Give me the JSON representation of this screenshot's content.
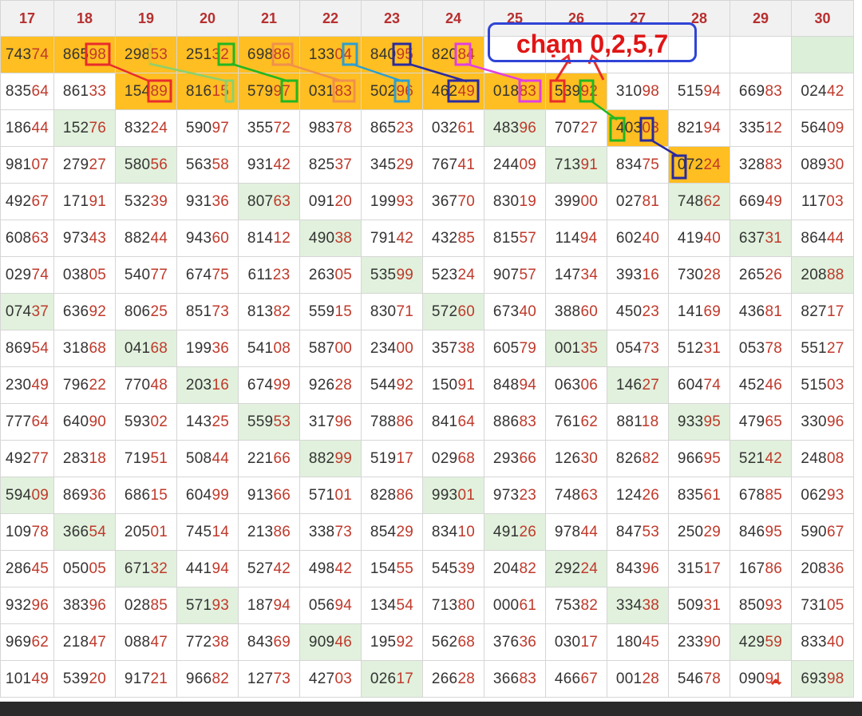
{
  "headers": [
    "17",
    "18",
    "19",
    "20",
    "21",
    "22",
    "23",
    "24",
    "25",
    "26",
    "27",
    "28",
    "29",
    "30"
  ],
  "annotation_text": "chạm 0,2,5,7",
  "scroll_top_icon": "chevron-up-icon",
  "colors": {
    "gold": "#ffbe21",
    "green": "#e1f1dd",
    "tail_red": "#c0392b",
    "note_border": "#2f44d6",
    "note_text": "#e01515"
  },
  "rows": [
    [
      [
        "74374",
        "gold"
      ],
      [
        "86598",
        "gold"
      ],
      [
        "29853",
        "gold"
      ],
      [
        "25132",
        "gold"
      ],
      [
        "69886",
        "gold"
      ],
      [
        "13304",
        "gold"
      ],
      [
        "84095",
        "gold"
      ],
      [
        "82084",
        "gold"
      ],
      [
        "",
        ""
      ],
      [
        "",
        ""
      ],
      [
        "",
        ""
      ],
      [
        "",
        ""
      ],
      [
        "",
        "empty"
      ],
      [
        "",
        "emptygreen"
      ]
    ],
    [
      [
        "83564",
        ""
      ],
      [
        "86133",
        ""
      ],
      [
        "15489",
        "gold"
      ],
      [
        "81615",
        "gold"
      ],
      [
        "57997",
        "gold"
      ],
      [
        "03183",
        "gold"
      ],
      [
        "50296",
        "gold"
      ],
      [
        "46249",
        "gold"
      ],
      [
        "01883",
        "gold"
      ],
      [
        "53992",
        "gold"
      ],
      [
        "31098",
        ""
      ],
      [
        "51594",
        ""
      ],
      [
        "66983",
        ""
      ],
      [
        "02442",
        ""
      ]
    ],
    [
      [
        "18644",
        ""
      ],
      [
        "15276",
        "green"
      ],
      [
        "83224",
        ""
      ],
      [
        "59097",
        ""
      ],
      [
        "35572",
        ""
      ],
      [
        "98378",
        ""
      ],
      [
        "86523",
        ""
      ],
      [
        "03261",
        ""
      ],
      [
        "48396",
        "green"
      ],
      [
        "70727",
        ""
      ],
      [
        "40303",
        "gold"
      ],
      [
        "82194",
        ""
      ],
      [
        "33512",
        ""
      ],
      [
        "56409",
        ""
      ]
    ],
    [
      [
        "98107",
        ""
      ],
      [
        "27927",
        ""
      ],
      [
        "58056",
        "green"
      ],
      [
        "56358",
        ""
      ],
      [
        "93142",
        ""
      ],
      [
        "82537",
        ""
      ],
      [
        "34529",
        ""
      ],
      [
        "76741",
        ""
      ],
      [
        "24409",
        ""
      ],
      [
        "71391",
        "green"
      ],
      [
        "83475",
        ""
      ],
      [
        "07224",
        "gold"
      ],
      [
        "32883",
        ""
      ],
      [
        "08930",
        ""
      ]
    ],
    [
      [
        "49267",
        ""
      ],
      [
        "17191",
        ""
      ],
      [
        "53239",
        ""
      ],
      [
        "93136",
        ""
      ],
      [
        "80763",
        "green"
      ],
      [
        "09120",
        ""
      ],
      [
        "19993",
        ""
      ],
      [
        "36770",
        ""
      ],
      [
        "83019",
        ""
      ],
      [
        "39900",
        ""
      ],
      [
        "02781",
        ""
      ],
      [
        "74862",
        "green"
      ],
      [
        "66949",
        ""
      ],
      [
        "11703",
        ""
      ]
    ],
    [
      [
        "60863",
        ""
      ],
      [
        "97343",
        ""
      ],
      [
        "88244",
        ""
      ],
      [
        "94360",
        ""
      ],
      [
        "81412",
        ""
      ],
      [
        "49038",
        "green"
      ],
      [
        "79142",
        ""
      ],
      [
        "43285",
        ""
      ],
      [
        "81557",
        ""
      ],
      [
        "11494",
        ""
      ],
      [
        "60240",
        ""
      ],
      [
        "41940",
        ""
      ],
      [
        "63731",
        "green"
      ],
      [
        "86444",
        ""
      ]
    ],
    [
      [
        "02974",
        ""
      ],
      [
        "03805",
        ""
      ],
      [
        "54077",
        ""
      ],
      [
        "67475",
        ""
      ],
      [
        "61123",
        ""
      ],
      [
        "26305",
        ""
      ],
      [
        "53599",
        "green"
      ],
      [
        "52324",
        ""
      ],
      [
        "90757",
        ""
      ],
      [
        "14734",
        ""
      ],
      [
        "39316",
        ""
      ],
      [
        "73028",
        ""
      ],
      [
        "26526",
        ""
      ],
      [
        "20888",
        "green"
      ]
    ],
    [
      [
        "07437",
        "green"
      ],
      [
        "63692",
        ""
      ],
      [
        "80625",
        ""
      ],
      [
        "85173",
        ""
      ],
      [
        "81382",
        ""
      ],
      [
        "55915",
        ""
      ],
      [
        "83071",
        ""
      ],
      [
        "57260",
        "green"
      ],
      [
        "67340",
        ""
      ],
      [
        "38860",
        ""
      ],
      [
        "45023",
        ""
      ],
      [
        "14169",
        ""
      ],
      [
        "43681",
        ""
      ],
      [
        "82717",
        ""
      ]
    ],
    [
      [
        "86954",
        ""
      ],
      [
        "31868",
        ""
      ],
      [
        "04168",
        "green"
      ],
      [
        "19936",
        ""
      ],
      [
        "54108",
        ""
      ],
      [
        "58700",
        ""
      ],
      [
        "23400",
        ""
      ],
      [
        "35738",
        ""
      ],
      [
        "60579",
        ""
      ],
      [
        "00135",
        "green"
      ],
      [
        "05473",
        ""
      ],
      [
        "51231",
        ""
      ],
      [
        "05378",
        ""
      ],
      [
        "55127",
        ""
      ]
    ],
    [
      [
        "23049",
        ""
      ],
      [
        "79622",
        ""
      ],
      [
        "77048",
        ""
      ],
      [
        "20316",
        "green"
      ],
      [
        "67499",
        ""
      ],
      [
        "92628",
        ""
      ],
      [
        "54492",
        ""
      ],
      [
        "15091",
        ""
      ],
      [
        "84894",
        ""
      ],
      [
        "06306",
        ""
      ],
      [
        "14627",
        "green"
      ],
      [
        "60474",
        ""
      ],
      [
        "45246",
        ""
      ],
      [
        "51503",
        ""
      ]
    ],
    [
      [
        "77764",
        ""
      ],
      [
        "64090",
        ""
      ],
      [
        "59302",
        ""
      ],
      [
        "14325",
        ""
      ],
      [
        "55953",
        "green"
      ],
      [
        "31796",
        ""
      ],
      [
        "78886",
        ""
      ],
      [
        "84164",
        ""
      ],
      [
        "88683",
        ""
      ],
      [
        "76162",
        ""
      ],
      [
        "88118",
        ""
      ],
      [
        "93395",
        "green"
      ],
      [
        "47965",
        ""
      ],
      [
        "33096",
        ""
      ]
    ],
    [
      [
        "49277",
        ""
      ],
      [
        "28318",
        ""
      ],
      [
        "71951",
        ""
      ],
      [
        "50844",
        ""
      ],
      [
        "22166",
        ""
      ],
      [
        "88299",
        "green"
      ],
      [
        "51917",
        ""
      ],
      [
        "02968",
        ""
      ],
      [
        "29366",
        ""
      ],
      [
        "12630",
        ""
      ],
      [
        "82682",
        ""
      ],
      [
        "96695",
        ""
      ],
      [
        "52142",
        "green"
      ],
      [
        "24808",
        ""
      ]
    ],
    [
      [
        "59409",
        "green"
      ],
      [
        "86936",
        ""
      ],
      [
        "68615",
        ""
      ],
      [
        "60499",
        ""
      ],
      [
        "91366",
        ""
      ],
      [
        "57101",
        ""
      ],
      [
        "82886",
        ""
      ],
      [
        "99301",
        "green"
      ],
      [
        "97323",
        ""
      ],
      [
        "74863",
        ""
      ],
      [
        "12426",
        ""
      ],
      [
        "83561",
        ""
      ],
      [
        "67885",
        ""
      ],
      [
        "06293",
        ""
      ]
    ],
    [
      [
        "10978",
        ""
      ],
      [
        "36654",
        "green"
      ],
      [
        "20501",
        ""
      ],
      [
        "74514",
        ""
      ],
      [
        "21386",
        ""
      ],
      [
        "33873",
        ""
      ],
      [
        "85429",
        ""
      ],
      [
        "83410",
        ""
      ],
      [
        "49126",
        "green"
      ],
      [
        "97844",
        ""
      ],
      [
        "84753",
        ""
      ],
      [
        "25029",
        ""
      ],
      [
        "84695",
        ""
      ],
      [
        "59067",
        ""
      ]
    ],
    [
      [
        "28645",
        ""
      ],
      [
        "05005",
        ""
      ],
      [
        "67132",
        "green"
      ],
      [
        "44194",
        ""
      ],
      [
        "52742",
        ""
      ],
      [
        "49842",
        ""
      ],
      [
        "15455",
        ""
      ],
      [
        "54539",
        ""
      ],
      [
        "20482",
        ""
      ],
      [
        "29224",
        "green"
      ],
      [
        "84396",
        ""
      ],
      [
        "31517",
        ""
      ],
      [
        "16786",
        ""
      ],
      [
        "20836",
        ""
      ]
    ],
    [
      [
        "93296",
        ""
      ],
      [
        "38396",
        ""
      ],
      [
        "02885",
        ""
      ],
      [
        "57193",
        "green"
      ],
      [
        "18794",
        ""
      ],
      [
        "05694",
        ""
      ],
      [
        "13454",
        ""
      ],
      [
        "71380",
        ""
      ],
      [
        "00061",
        ""
      ],
      [
        "75382",
        ""
      ],
      [
        "33438",
        "green"
      ],
      [
        "50931",
        ""
      ],
      [
        "85093",
        ""
      ],
      [
        "73105",
        ""
      ]
    ],
    [
      [
        "96962",
        ""
      ],
      [
        "21847",
        ""
      ],
      [
        "08847",
        ""
      ],
      [
        "77238",
        ""
      ],
      [
        "84369",
        ""
      ],
      [
        "90946",
        "green"
      ],
      [
        "19592",
        ""
      ],
      [
        "56268",
        ""
      ],
      [
        "37636",
        ""
      ],
      [
        "03017",
        ""
      ],
      [
        "18045",
        ""
      ],
      [
        "23390",
        ""
      ],
      [
        "42959",
        "green"
      ],
      [
        "83340",
        ""
      ]
    ],
    [
      [
        "10149",
        ""
      ],
      [
        "53920",
        ""
      ],
      [
        "91721",
        ""
      ],
      [
        "96682",
        ""
      ],
      [
        "12773",
        ""
      ],
      [
        "42703",
        ""
      ],
      [
        "02617",
        "green"
      ],
      [
        "26628",
        ""
      ],
      [
        "36683",
        ""
      ],
      [
        "46667",
        ""
      ],
      [
        "00128",
        ""
      ],
      [
        "54678",
        ""
      ],
      [
        "09091",
        ""
      ],
      [
        "69398",
        "green"
      ]
    ]
  ]
}
